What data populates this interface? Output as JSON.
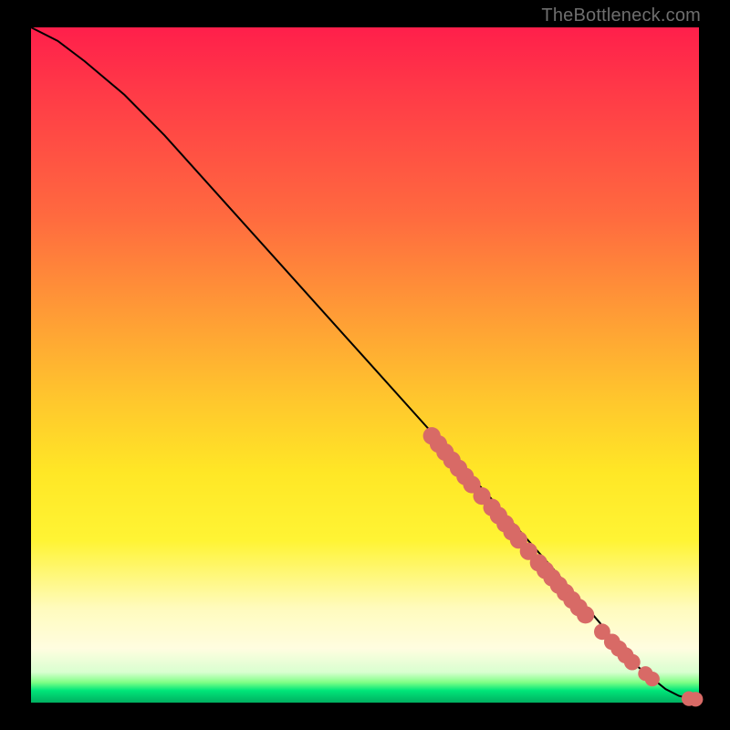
{
  "attribution": "TheBottleneck.com",
  "chart_data": {
    "type": "line",
    "title": "",
    "xlabel": "",
    "ylabel": "",
    "xlim": [
      0,
      100
    ],
    "ylim": [
      0,
      100
    ],
    "grid": false,
    "series": [
      {
        "name": "bottleneck-curve",
        "x": [
          0,
          4,
          8,
          14,
          20,
          30,
          40,
          50,
          60,
          70,
          78,
          85,
          90,
          95,
          97,
          99,
          100
        ],
        "y": [
          100,
          98,
          95,
          90,
          84,
          73,
          62,
          51,
          40,
          29,
          20,
          12,
          6,
          2,
          1,
          0.5,
          0.5
        ],
        "stroke": "#000000",
        "stroke_width": 2
      }
    ],
    "markers": [
      {
        "name": "cluster-a",
        "cx": 60.0,
        "cy": 39.5,
        "r": 0.9,
        "color": "#d86a66"
      },
      {
        "name": "cluster-a",
        "cx": 61.0,
        "cy": 38.3,
        "r": 0.9,
        "color": "#d86a66"
      },
      {
        "name": "cluster-a",
        "cx": 62.0,
        "cy": 37.1,
        "r": 0.9,
        "color": "#d86a66"
      },
      {
        "name": "cluster-a",
        "cx": 63.0,
        "cy": 35.9,
        "r": 0.9,
        "color": "#d86a66"
      },
      {
        "name": "cluster-a",
        "cx": 64.0,
        "cy": 34.7,
        "r": 0.9,
        "color": "#d86a66"
      },
      {
        "name": "cluster-a",
        "cx": 65.0,
        "cy": 33.5,
        "r": 0.9,
        "color": "#d86a66"
      },
      {
        "name": "cluster-a",
        "cx": 66.0,
        "cy": 32.3,
        "r": 0.9,
        "color": "#d86a66"
      },
      {
        "name": "cluster-a",
        "cx": 67.5,
        "cy": 30.6,
        "r": 0.9,
        "color": "#d86a66"
      },
      {
        "name": "cluster-a",
        "cx": 69.0,
        "cy": 28.9,
        "r": 0.9,
        "color": "#d86a66"
      },
      {
        "name": "cluster-a",
        "cx": 70.0,
        "cy": 27.7,
        "r": 0.9,
        "color": "#d86a66"
      },
      {
        "name": "cluster-a",
        "cx": 71.0,
        "cy": 26.5,
        "r": 0.9,
        "color": "#d86a66"
      },
      {
        "name": "cluster-a",
        "cx": 72.0,
        "cy": 25.3,
        "r": 0.9,
        "color": "#d86a66"
      },
      {
        "name": "cluster-a",
        "cx": 73.0,
        "cy": 24.1,
        "r": 0.9,
        "color": "#d86a66"
      },
      {
        "name": "cluster-a",
        "cx": 74.5,
        "cy": 22.4,
        "r": 0.9,
        "color": "#d86a66"
      },
      {
        "name": "cluster-a",
        "cx": 76.0,
        "cy": 20.7,
        "r": 0.9,
        "color": "#d86a66"
      },
      {
        "name": "cluster-a",
        "cx": 77.0,
        "cy": 19.6,
        "r": 0.9,
        "color": "#d86a66"
      },
      {
        "name": "cluster-a",
        "cx": 78.0,
        "cy": 18.5,
        "r": 0.9,
        "color": "#d86a66"
      },
      {
        "name": "cluster-a",
        "cx": 79.0,
        "cy": 17.4,
        "r": 0.9,
        "color": "#d86a66"
      },
      {
        "name": "cluster-a",
        "cx": 80.0,
        "cy": 16.3,
        "r": 0.9,
        "color": "#d86a66"
      },
      {
        "name": "cluster-a",
        "cx": 81.0,
        "cy": 15.2,
        "r": 0.9,
        "color": "#d86a66"
      },
      {
        "name": "cluster-a",
        "cx": 82.0,
        "cy": 14.1,
        "r": 0.9,
        "color": "#d86a66"
      },
      {
        "name": "cluster-a",
        "cx": 83.0,
        "cy": 13.0,
        "r": 0.9,
        "color": "#d86a66"
      },
      {
        "name": "cluster-b",
        "cx": 85.5,
        "cy": 10.5,
        "r": 0.8,
        "color": "#d86a66"
      },
      {
        "name": "cluster-b",
        "cx": 87.0,
        "cy": 9.0,
        "r": 0.8,
        "color": "#d86a66"
      },
      {
        "name": "cluster-b",
        "cx": 88.0,
        "cy": 8.0,
        "r": 0.8,
        "color": "#d86a66"
      },
      {
        "name": "cluster-b",
        "cx": 89.0,
        "cy": 7.0,
        "r": 0.8,
        "color": "#d86a66"
      },
      {
        "name": "cluster-b",
        "cx": 90.0,
        "cy": 6.0,
        "r": 0.8,
        "color": "#d86a66"
      },
      {
        "name": "cluster-c",
        "cx": 92.0,
        "cy": 4.3,
        "r": 0.7,
        "color": "#d86a66"
      },
      {
        "name": "cluster-c",
        "cx": 93.0,
        "cy": 3.5,
        "r": 0.7,
        "color": "#d86a66"
      },
      {
        "name": "tail",
        "cx": 98.5,
        "cy": 0.6,
        "r": 0.7,
        "color": "#d86a66"
      },
      {
        "name": "tail",
        "cx": 99.5,
        "cy": 0.5,
        "r": 0.7,
        "color": "#d86a66"
      }
    ]
  }
}
